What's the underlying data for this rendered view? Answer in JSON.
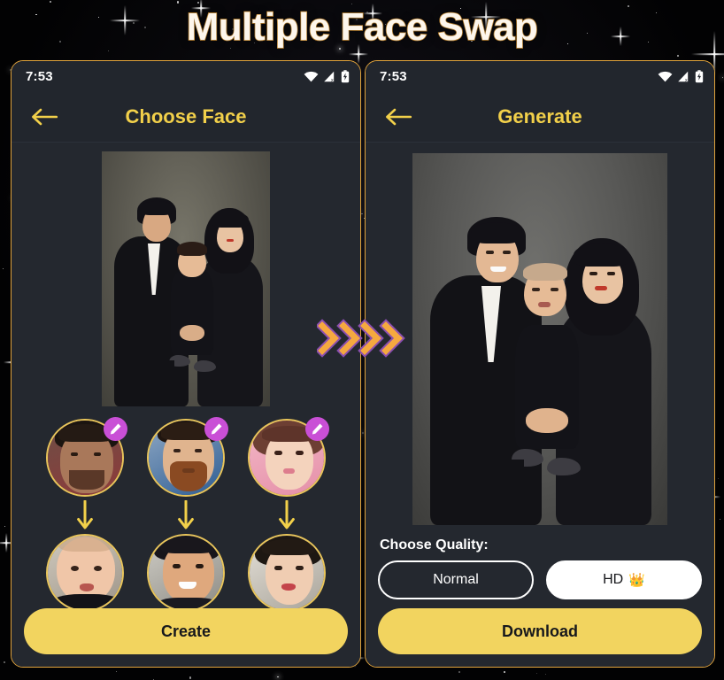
{
  "headline": "Multiple Face Swap",
  "accent": {
    "gold": "#f2d04a",
    "gold_border": "#e0a33c",
    "button": "#f2d45f",
    "badge_purple": "#c94fd6",
    "panel_bg": "#24282f",
    "chevron_orange": "#f5a93f",
    "chevron_outline": "#8b4fb0"
  },
  "left_panel": {
    "status": {
      "time": "7:53",
      "icons": [
        "wifi-icon",
        "signal-icon",
        "battery-charging-icon"
      ]
    },
    "appbar": {
      "back_icon": "back-arrow-icon",
      "title": "Choose Face"
    },
    "main_photo_alt": "family-portrait-original",
    "source_faces": [
      {
        "id": "source-face-1",
        "label": "source-face-1",
        "badge_icon": "edit-pencil-icon"
      },
      {
        "id": "source-face-2",
        "label": "source-face-2",
        "badge_icon": "edit-pencil-icon"
      },
      {
        "id": "source-face-3",
        "label": "source-face-3",
        "badge_icon": "edit-pencil-icon"
      }
    ],
    "arrows": [
      "down-arrow-icon",
      "down-arrow-icon",
      "down-arrow-icon"
    ],
    "target_faces": [
      {
        "id": "target-face-1",
        "label": "target-face-1"
      },
      {
        "id": "target-face-2",
        "label": "target-face-2"
      },
      {
        "id": "target-face-3",
        "label": "target-face-3"
      }
    ],
    "primary_button": "Create"
  },
  "right_panel": {
    "status": {
      "time": "7:53",
      "icons": [
        "wifi-icon",
        "signal-icon",
        "battery-charging-icon"
      ]
    },
    "appbar": {
      "back_icon": "back-arrow-icon",
      "title": "Generate"
    },
    "result_photo_alt": "family-portrait-face-swapped",
    "quality": {
      "label": "Choose Quality:",
      "options": [
        {
          "label": "Normal",
          "selected": false
        },
        {
          "label": "HD",
          "crown": "👑",
          "selected": true
        }
      ]
    },
    "primary_button": "Download"
  },
  "transition": {
    "icon": "chevrons-right-icon",
    "count": 4
  }
}
